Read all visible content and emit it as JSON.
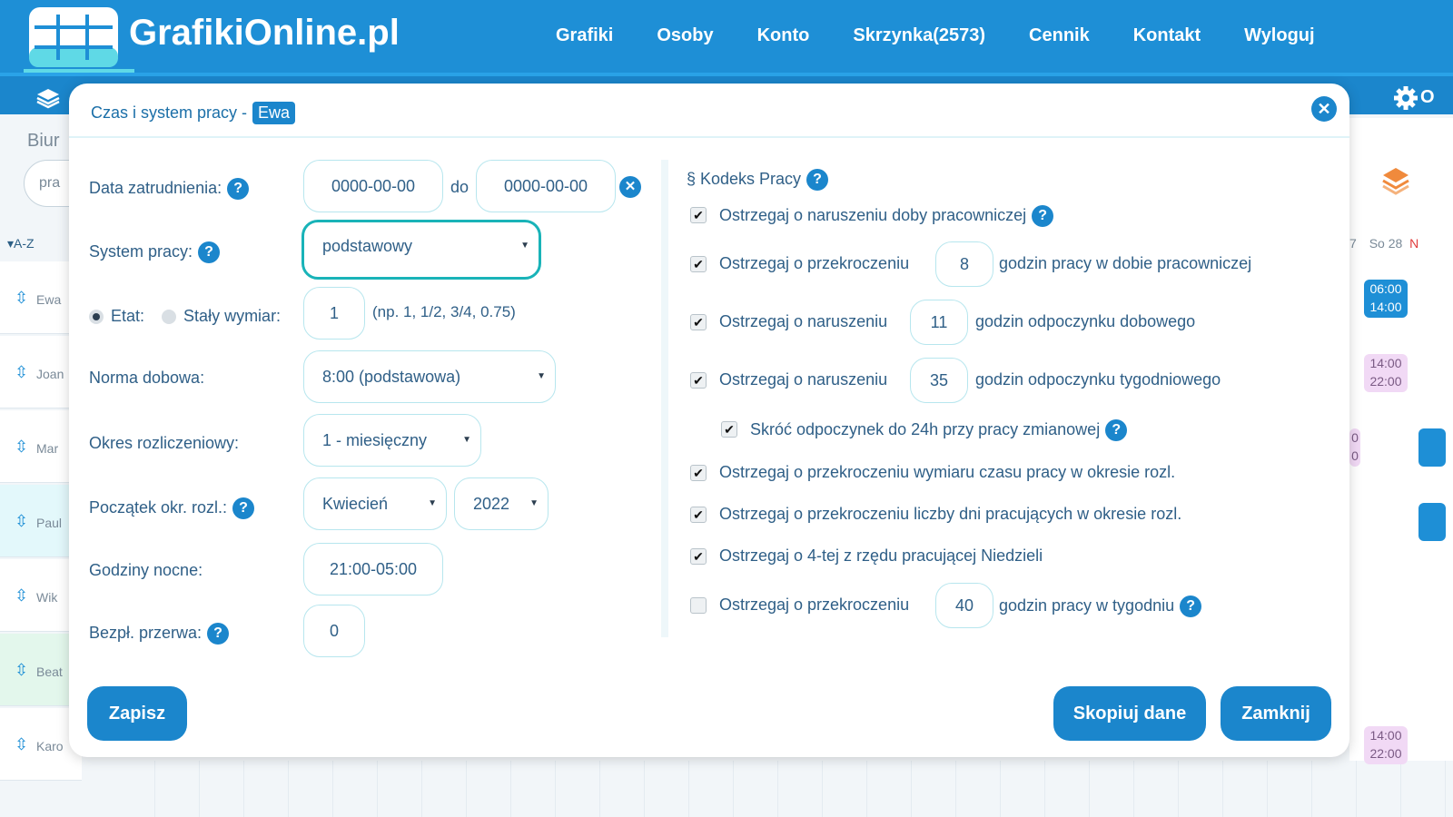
{
  "brand": "GrafikiOnline.pl",
  "nav": [
    "Grafiki",
    "Osoby",
    "Konto",
    "Skrzynka(2573)",
    "Cennik",
    "Kontakt",
    "Wyloguj"
  ],
  "subbar": {
    "right_label": "O"
  },
  "background": {
    "section_title": "Biur",
    "search_value": "pra",
    "sort_label": "▾A-Z",
    "people": [
      "Ewa",
      "Joan",
      "Mar",
      "Paul",
      "Wik",
      "Beat",
      "Karo"
    ],
    "days_header": [
      "7",
      "So 28",
      "N"
    ],
    "shifts": [
      "06:00",
      "14:00",
      "14:00",
      "22:00",
      "0",
      "0",
      "14:00",
      "22:00"
    ]
  },
  "modal": {
    "title": "Czas i system pracy -",
    "person_badge": "Ewa",
    "left": {
      "employment_date_label": "Data zatrudnienia:",
      "employment_from": "0000-00-00",
      "to_label": "do",
      "employment_to": "0000-00-00",
      "work_system_label": "System pracy:",
      "work_system_value": "podstawowy",
      "etat_label": "Etat:",
      "fixed_label": "Stały wymiar:",
      "etat_value": "1",
      "etat_hint": "(np. 1, 1/2, 3/4, 0.75)",
      "daily_norm_label": "Norma dobowa:",
      "daily_norm_value": "8:00 (podstawowa)",
      "settlement_label": "Okres rozliczeniowy:",
      "settlement_value": "1 - miesięczny",
      "settlement_start_label": "Początek okr. rozl.:",
      "settlement_month": "Kwiecień",
      "settlement_year": "2022",
      "night_hours_label": "Godziny nocne:",
      "night_hours_value": "21:00-05:00",
      "unpaid_break_label": "Bezpł. przerwa:",
      "unpaid_break_value": "0"
    },
    "right": {
      "section_title": "§ Kodeks Pracy",
      "rules": [
        {
          "checked": true,
          "text": "Ostrzegaj o naruszeniu doby pracowniczej"
        },
        {
          "checked": true,
          "pre": "Ostrzegaj o przekroczeniu",
          "value": "8",
          "post": "godzin pracy w dobie pracowniczej"
        },
        {
          "checked": true,
          "pre": "Ostrzegaj o naruszeniu",
          "value": "11",
          "post": "godzin odpoczynku dobowego"
        },
        {
          "checked": true,
          "pre": "Ostrzegaj o naruszeniu",
          "value": "35",
          "post": "godzin odpoczynku tygodniowego"
        },
        {
          "checked": true,
          "text": "Skróć odpoczynek do 24h przy pracy zmianowej"
        },
        {
          "checked": true,
          "text": "Ostrzegaj o przekroczeniu wymiaru czasu pracy w okresie rozl."
        },
        {
          "checked": true,
          "text": "Ostrzegaj o przekroczeniu liczby dni pracujących w okresie rozl."
        },
        {
          "checked": true,
          "text": "Ostrzegaj o 4-tej z rzędu pracującej Niedzieli"
        },
        {
          "checked": false,
          "pre": "Ostrzegaj o przekroczeniu",
          "value": "40",
          "post": "godzin pracy w tygodniu"
        }
      ]
    },
    "buttons": {
      "save": "Zapisz",
      "copy": "Skopiuj dane",
      "close": "Zamknij"
    }
  },
  "colors": {
    "primary": "#1e8fd6",
    "accent": "#19b3b8",
    "label": "#2f5f87"
  },
  "icons": {
    "help": "?",
    "close": "×",
    "check": "✔"
  }
}
